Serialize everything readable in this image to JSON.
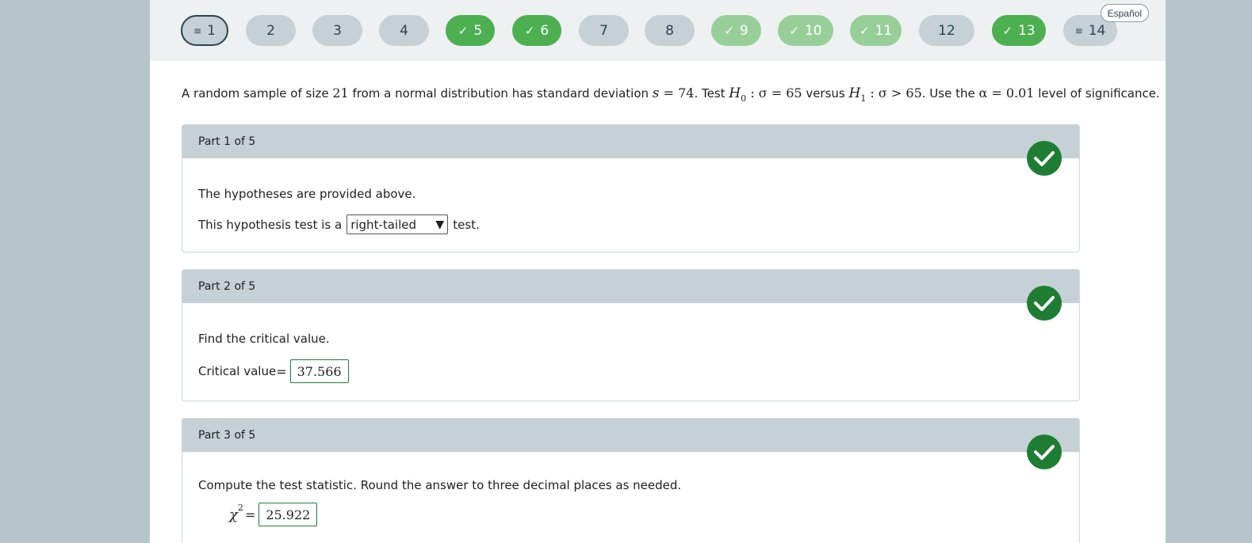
{
  "nav": {
    "questions": [
      {
        "label": "1",
        "state": "neutral",
        "glyph": "list"
      },
      {
        "label": "2",
        "state": "neutral",
        "glyph": ""
      },
      {
        "label": "3",
        "state": "neutral",
        "glyph": ""
      },
      {
        "label": "4",
        "state": "neutral",
        "glyph": ""
      },
      {
        "label": "5",
        "state": "done",
        "glyph": "check"
      },
      {
        "label": "6",
        "state": "done",
        "glyph": "check"
      },
      {
        "label": "7",
        "state": "neutral",
        "glyph": ""
      },
      {
        "label": "8",
        "state": "neutral",
        "glyph": ""
      },
      {
        "label": "9",
        "state": "partial",
        "glyph": "check"
      },
      {
        "label": "10",
        "state": "partial",
        "glyph": "check"
      },
      {
        "label": "11",
        "state": "partial",
        "glyph": "check"
      },
      {
        "label": "12",
        "state": "neutral",
        "glyph": ""
      },
      {
        "label": "13",
        "state": "done",
        "glyph": "check"
      },
      {
        "label": "14",
        "state": "neutral",
        "glyph": "list"
      }
    ],
    "current": "1",
    "language_button": "Español"
  },
  "problem": {
    "t1": "A random sample of size ",
    "n": "21",
    "t2": " from a normal distribution has standard deviation ",
    "s_var": "s",
    "s_eq": " = 74",
    "t3": ". Test ",
    "h0": "H",
    "h0_sub": "0",
    "h0_rest": " : σ = 65",
    "t4": " versus ",
    "h1": "H",
    "h1_sub": "1",
    "h1_rest": " : σ > 65",
    "t5": ". Use the ",
    "alpha": "α = 0.01",
    "t6": " level of significance."
  },
  "parts": {
    "p1": {
      "header": "Part 1 of 5",
      "line1": "The hypotheses are provided above.",
      "line2_pre": "This hypothesis test is a",
      "select_value": "right-tailed",
      "line2_post": "test."
    },
    "p2": {
      "header": "Part 2 of 5",
      "line1": "Find the critical value.",
      "label": "Critical value",
      "eq": "=",
      "answer": "37.566"
    },
    "p3": {
      "header": "Part 3 of 5",
      "line1": "Compute the test statistic. Round the answer to three decimal places as needed.",
      "chi": "χ",
      "sup": "2",
      "eq": "=",
      "answer": "25.922"
    }
  },
  "sidebar_icons": [
    "glasses-icon",
    "directions-icon",
    "notes-icon",
    "ebook-icon",
    "mail-icon"
  ],
  "colors": {
    "correct": "#1e7d33",
    "done": "#4caf50",
    "partial": "#98cf99",
    "neutral": "#c5d1d6"
  }
}
